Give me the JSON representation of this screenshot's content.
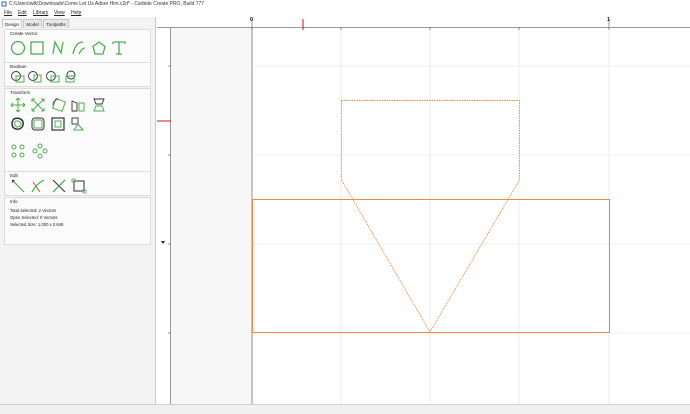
{
  "window": {
    "title": "C:\\Users\\wlk\\Downloads\\Come Let Us Adore Him.c2d* - Carbide Create PRO, Build 777"
  },
  "menu": {
    "items": [
      "File",
      "Edit",
      "Library",
      "View",
      "Help"
    ]
  },
  "tabs": [
    "Design",
    "Model",
    "Toolpaths"
  ],
  "sections": {
    "create_vector": "Create Vector",
    "boolean": "Boolean",
    "transform": "Transform",
    "edit": "Edit",
    "info": "Info"
  },
  "info": {
    "total_selected": "Total Selected:  2 Vectors",
    "open_selected": "Open Selected:  0 Vectors",
    "selected_size": "Selected Size:    1.000 x 0.649"
  },
  "rulers": {
    "x_labels": [
      "0",
      "1"
    ]
  },
  "colors": {
    "accent_green": "#4caf50",
    "vector_orange": "#f08a3c",
    "ruler_red": "#d01010"
  }
}
